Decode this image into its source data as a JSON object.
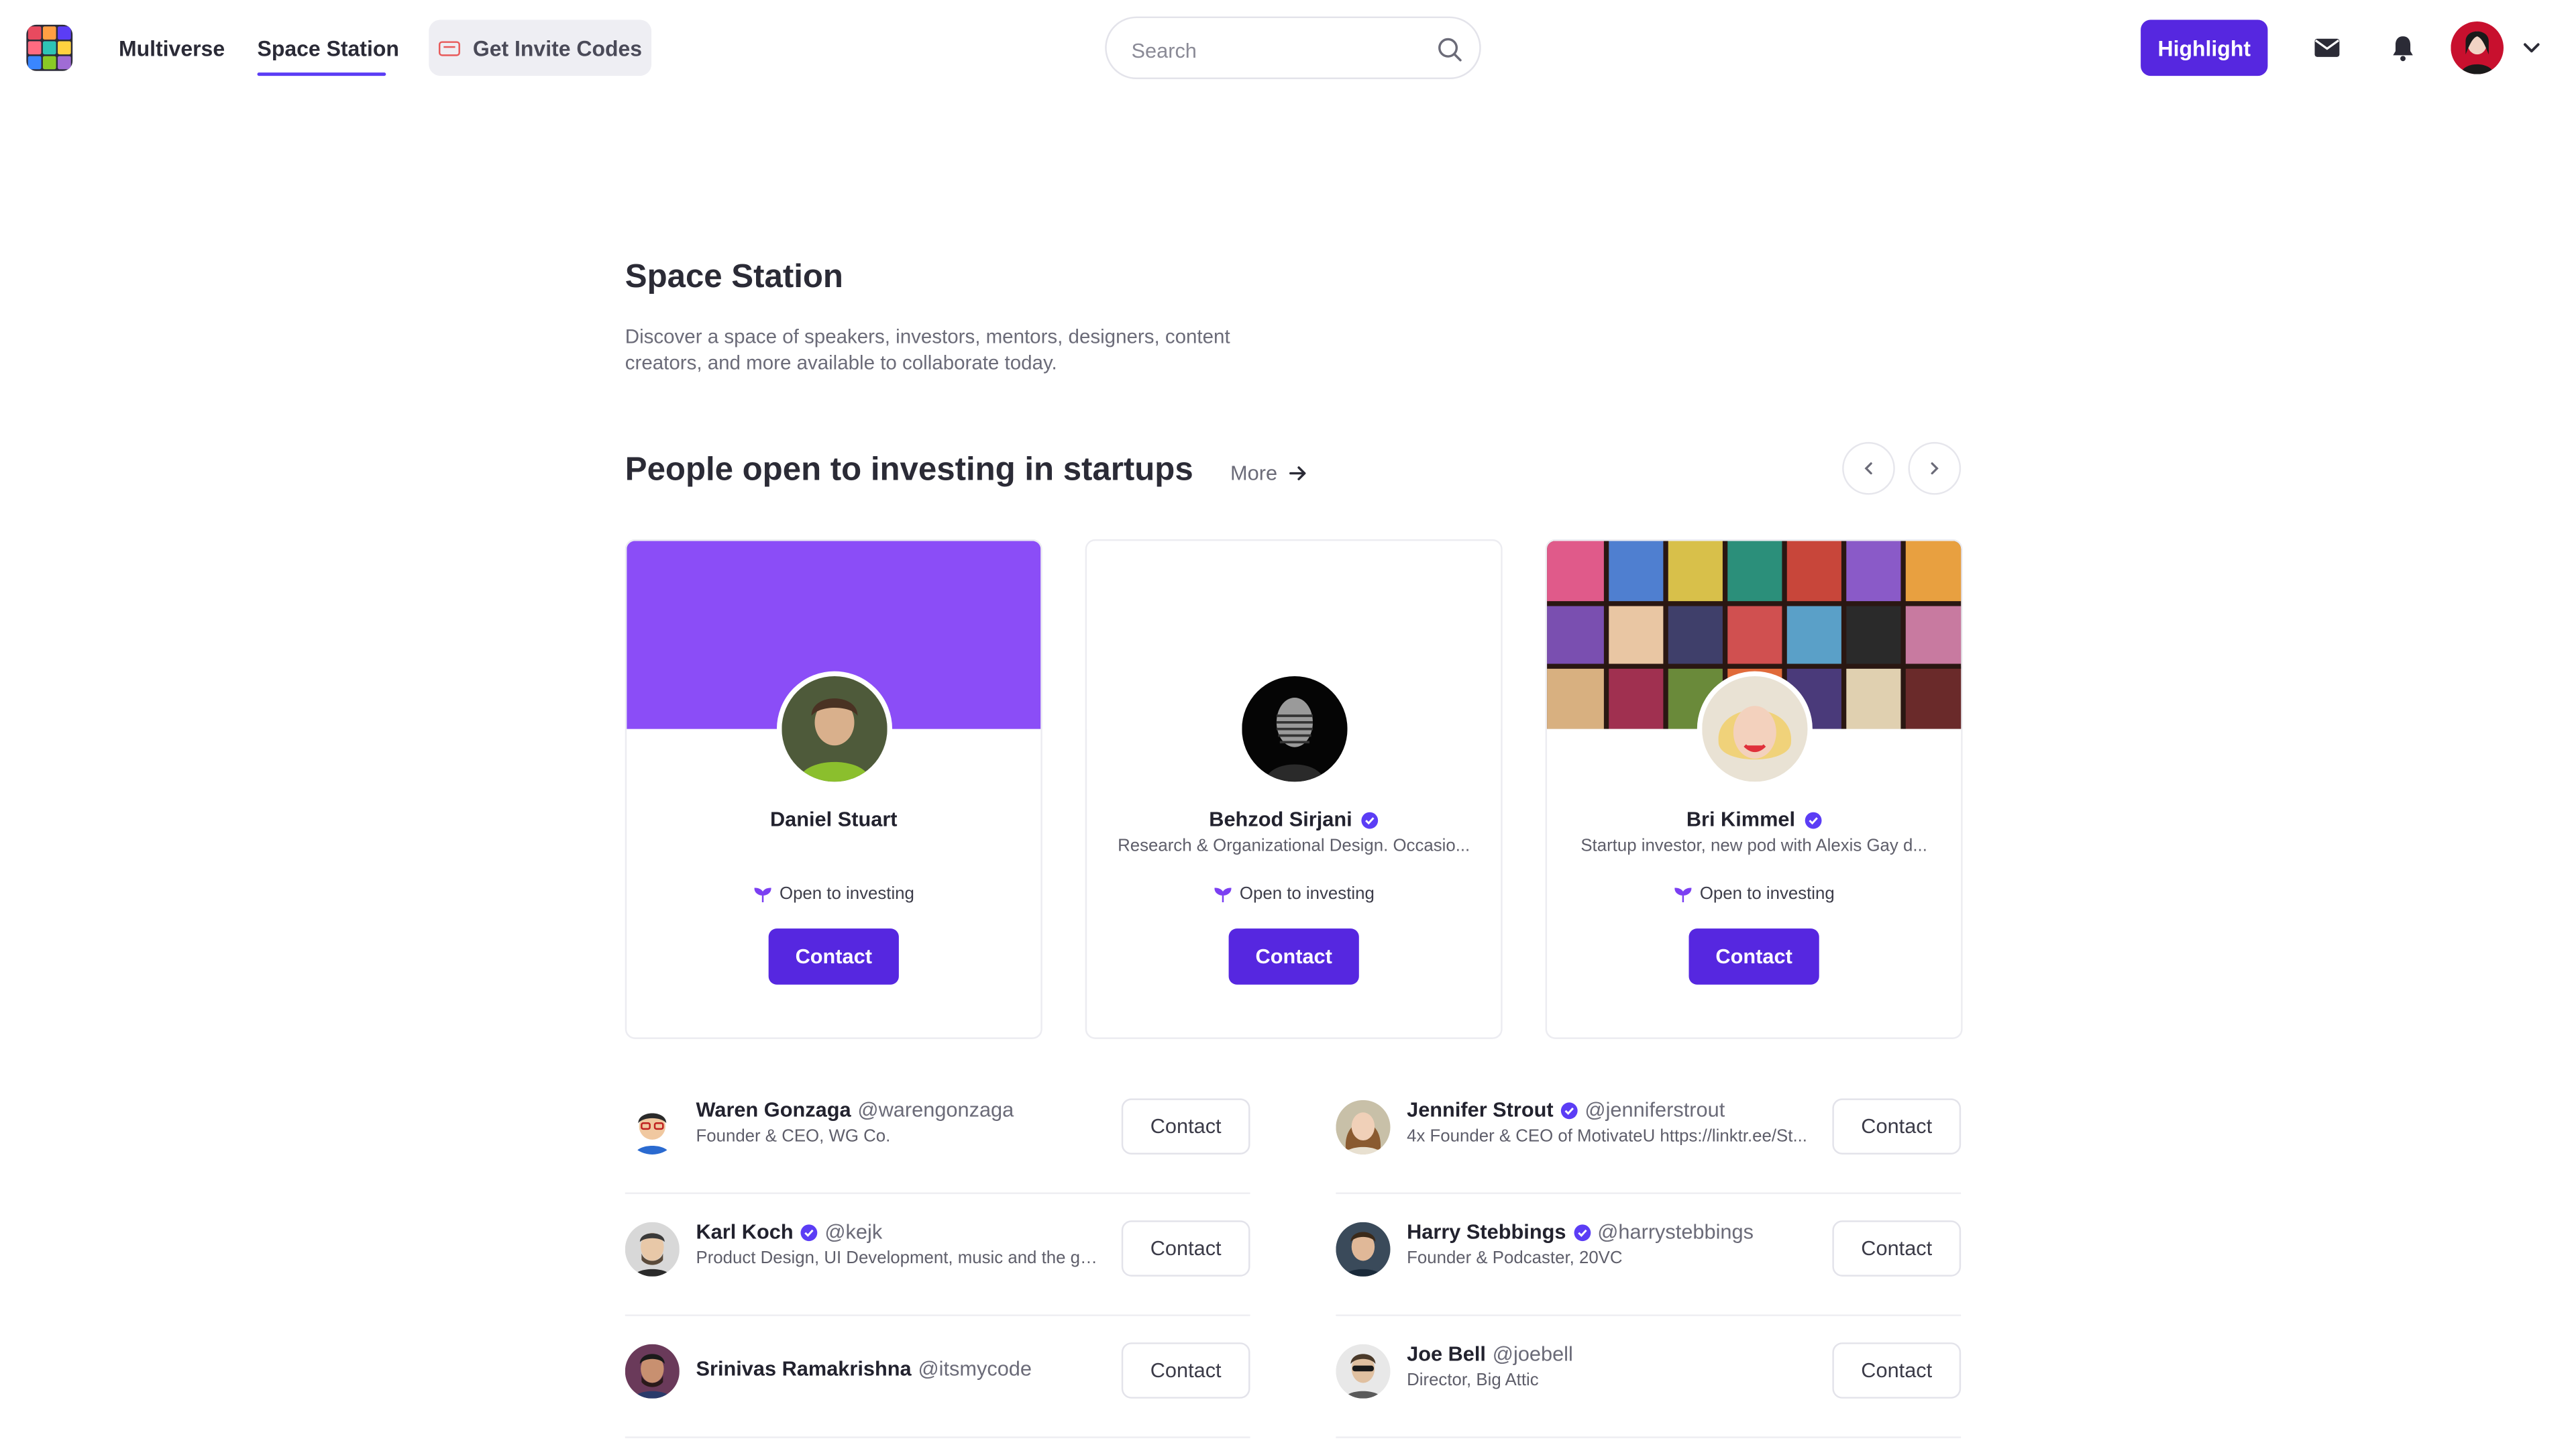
{
  "nav": {
    "links": [
      "Multiverse",
      "Space Station"
    ],
    "invite_label": "Get Invite Codes",
    "search_placeholder": "Search",
    "highlight_label": "Highlight"
  },
  "header": {
    "title": "Space Station",
    "description": "Discover a space of speakers, investors, mentors, designers, content creators, and more available to collaborate today."
  },
  "section": {
    "title": "People open to investing in startups",
    "more_label": "More"
  },
  "featured": [
    {
      "name": "Daniel Stuart",
      "bio": "",
      "badge": "Open to investing",
      "contact": "Contact",
      "verified": false
    },
    {
      "name": "Behzod Sirjani",
      "bio": "Research & Organizational Design. Occasio...",
      "badge": "Open to investing",
      "contact": "Contact",
      "verified": true
    },
    {
      "name": "Bri Kimmel",
      "bio": "Startup investor, new pod with Alexis Gay d...",
      "badge": "Open to investing",
      "contact": "Contact",
      "verified": true
    }
  ],
  "people": [
    {
      "name": "Waren Gonzaga",
      "handle": "@warengonzaga",
      "bio": "Founder & CEO, WG Co.",
      "contact": "Contact",
      "verified": false
    },
    {
      "name": "Jennifer Strout",
      "handle": "@jenniferstrout",
      "bio": "4x Founder & CEO of MotivateU https://linktr.ee/St...",
      "contact": "Contact",
      "verified": true
    },
    {
      "name": "Karl Koch",
      "handle": "@kejk",
      "bio": "Product Design, UI Development, music and the gr...",
      "contact": "Contact",
      "verified": true
    },
    {
      "name": "Harry Stebbings",
      "handle": "@harrystebbings",
      "bio": "Founder & Podcaster, 20VC",
      "contact": "Contact",
      "verified": true
    },
    {
      "name": "Srinivas Ramakrishna",
      "handle": "@itsmycode",
      "bio": "",
      "contact": "Contact",
      "verified": false
    },
    {
      "name": "Joe Bell",
      "handle": "@joebell",
      "bio": "Director, Big Attic",
      "contact": "Contact",
      "verified": false
    }
  ],
  "colors": {
    "accent": "#5627e0",
    "cover_purple": "#8b4df7",
    "verified": "#5b3df5"
  }
}
